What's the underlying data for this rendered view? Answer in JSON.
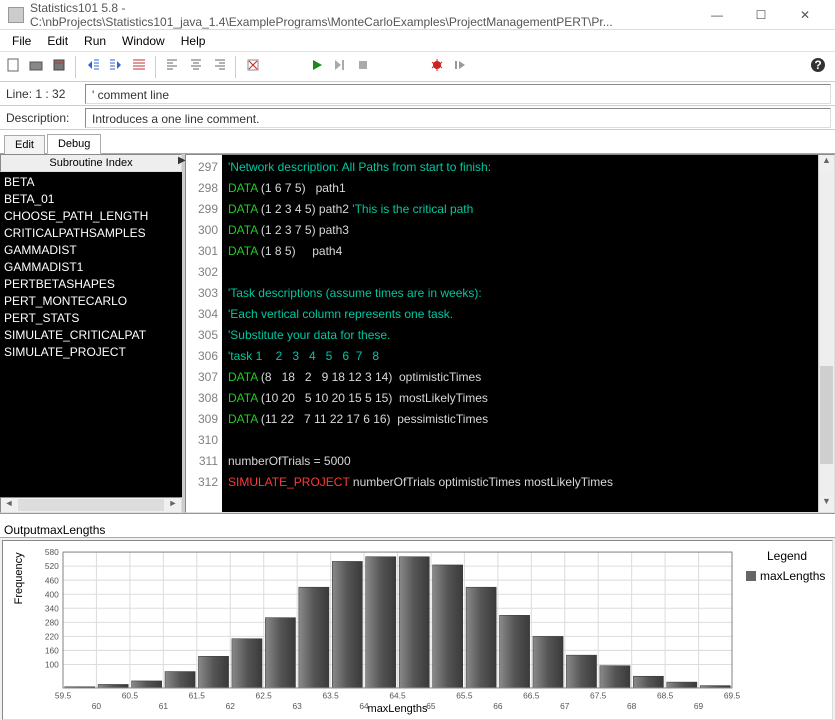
{
  "titlebar": {
    "title": "Statistics101 5.8 - C:\\nbProjects\\Statistics101_java_1.4\\ExamplePrograms\\MonteCarloExamples\\ProjectManagementPERT\\Pr..."
  },
  "menu": {
    "file": "File",
    "edit": "Edit",
    "run": "Run",
    "window": "Window",
    "help": "Help"
  },
  "lineinfo": {
    "label": "Line: 1 : 32",
    "value": "' comment line"
  },
  "descinfo": {
    "label": "Description:",
    "value": "Introduces a one line comment."
  },
  "editor_tabs": {
    "edit": "Edit",
    "debug": "Debug"
  },
  "side_panel": {
    "header": "Subroutine Index",
    "items": [
      "BETA",
      "BETA_01",
      "CHOOSE_PATH_LENGTH",
      "CRITICALPATHSAMPLES",
      "GAMMADIST",
      "GAMMADIST1",
      "PERTBETASHAPES",
      "PERT_MONTECARLO",
      "PERT_STATS",
      "SIMULATE_CRITICALPAT",
      "SIMULATE_PROJECT"
    ]
  },
  "gutter": {
    "start": 297,
    "count": 16
  },
  "code": [
    {
      "t": "cmt",
      "v": "'Network description: All Paths from start to finish:"
    },
    {
      "t": "mix",
      "parts": [
        {
          "c": "kw",
          "v": "DATA"
        },
        {
          "c": "txt",
          "v": " (1 6 7 5)   path1"
        }
      ]
    },
    {
      "t": "mix",
      "parts": [
        {
          "c": "kw",
          "v": "DATA"
        },
        {
          "c": "txt",
          "v": " (1 2 3 4 5) path2 "
        },
        {
          "c": "cmt",
          "v": "'This is the critical path"
        }
      ]
    },
    {
      "t": "mix",
      "parts": [
        {
          "c": "kw",
          "v": "DATA"
        },
        {
          "c": "txt",
          "v": " (1 2 3 7 5) path3"
        }
      ]
    },
    {
      "t": "mix",
      "parts": [
        {
          "c": "kw",
          "v": "DATA"
        },
        {
          "c": "txt",
          "v": " (1 8 5)     path4"
        }
      ]
    },
    {
      "t": "txt",
      "v": ""
    },
    {
      "t": "cmt",
      "v": "'Task descriptions (assume times are in weeks):"
    },
    {
      "t": "cmt",
      "v": "'Each vertical column represents one task."
    },
    {
      "t": "cmt",
      "v": "'Substitute your data for these."
    },
    {
      "t": "cmt",
      "v": "'task 1    2   3   4   5   6  7   8"
    },
    {
      "t": "mix",
      "parts": [
        {
          "c": "kw",
          "v": "DATA"
        },
        {
          "c": "txt",
          "v": " (8   18   2   9 18 12 3 14)  optimisticTimes"
        }
      ]
    },
    {
      "t": "mix",
      "parts": [
        {
          "c": "kw",
          "v": "DATA"
        },
        {
          "c": "txt",
          "v": " (10 20   5 10 20 15 5 15)  mostLikelyTimes"
        }
      ]
    },
    {
      "t": "mix",
      "parts": [
        {
          "c": "kw",
          "v": "DATA"
        },
        {
          "c": "txt",
          "v": " (11 22   7 11 22 17 6 16)  pessimisticTimes"
        }
      ]
    },
    {
      "t": "txt",
      "v": ""
    },
    {
      "t": "txt",
      "v": "numberOfTrials = 5000"
    },
    {
      "t": "mix",
      "parts": [
        {
          "c": "red",
          "v": "SIMULATE_PROJECT"
        },
        {
          "c": "txt",
          "v": " numberOfTrials optimisticTimes mostLikelyTimes"
        }
      ]
    }
  ],
  "bottom_tabs": {
    "output": "Output",
    "maxlen": "maxLengths"
  },
  "chart_data": {
    "type": "bar",
    "title": "",
    "xlabel": "maxLengths",
    "ylabel": "Frequency",
    "legend_title": "Legend",
    "series_name": "maxLengths",
    "xlim": [
      59.5,
      69.5
    ],
    "ylim": [
      0,
      580
    ],
    "categories": [
      59.75,
      60.25,
      60.75,
      61.25,
      61.75,
      62.25,
      62.75,
      63.25,
      63.75,
      64.25,
      64.75,
      65.25,
      65.75,
      66.25,
      66.75,
      67.25,
      67.75,
      68.25,
      68.75,
      69.25
    ],
    "values": [
      5,
      15,
      30,
      70,
      135,
      210,
      300,
      430,
      540,
      560,
      560,
      525,
      430,
      310,
      220,
      140,
      95,
      50,
      25,
      10
    ],
    "xticks": [
      59.5,
      60,
      60.5,
      61,
      61.5,
      62,
      62.5,
      63,
      63.5,
      64,
      64.5,
      65,
      65.5,
      66,
      66.5,
      67,
      67.5,
      68,
      68.5,
      69,
      69.5
    ],
    "yticks": [
      100,
      160,
      220,
      280,
      340,
      400,
      460,
      520,
      580
    ]
  }
}
